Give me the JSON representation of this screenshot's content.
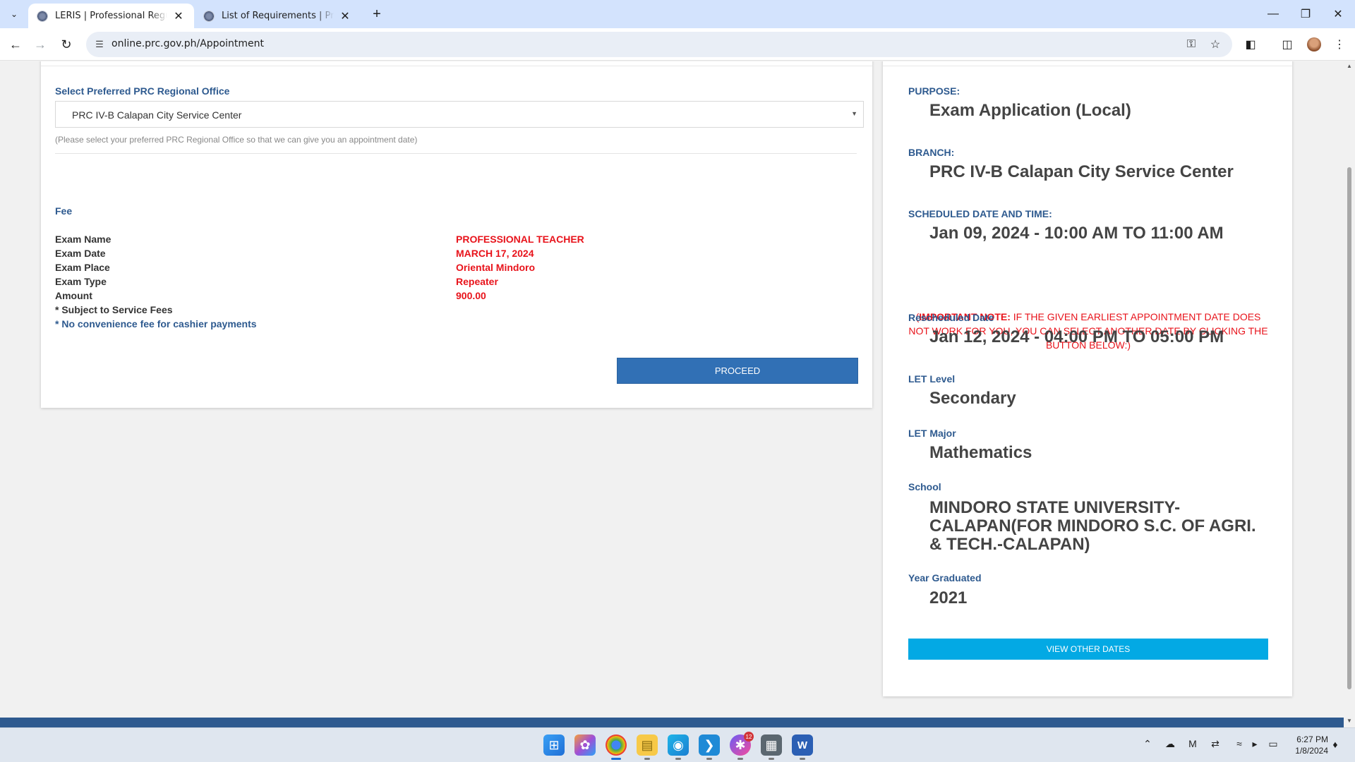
{
  "browser": {
    "tabs": [
      {
        "title": "LERIS | Professional Regulation",
        "active": true
      },
      {
        "title": "List of Requirements | Professio",
        "active": false
      }
    ],
    "url": "online.prc.gov.ph/Appointment"
  },
  "office": {
    "label": "Select Preferred PRC Regional Office",
    "selected": "PRC IV-B Calapan City Service Center",
    "hint": "(Please select your preferred PRC Regional Office so that we can give you an appointment date)"
  },
  "fee": {
    "heading": "Fee",
    "rows": [
      {
        "label": "Exam Name",
        "value": "PROFESSIONAL TEACHER"
      },
      {
        "label": "Exam Date",
        "value": "MARCH 17, 2024"
      },
      {
        "label": "Exam Place",
        "value": "Oriental Mindoro"
      },
      {
        "label": "Exam Type",
        "value": "Repeater"
      },
      {
        "label": "Amount",
        "value": "900.00"
      }
    ],
    "note1": "* Subject to Service Fees",
    "note2": "* No convenience fee for cashier payments",
    "proceed_label": "PROCEED"
  },
  "summary": {
    "purpose_label": "PURPOSE:",
    "purpose": "Exam Application (Local)",
    "branch_label": "BRANCH:",
    "branch": "PRC IV-B Calapan City Service Center",
    "schedule_label": "SCHEDULED DATE AND TIME:",
    "schedule": "Jan 09, 2024 - 10:00 AM TO 11:00 AM",
    "note_open": "(",
    "note_bold": "IMPORTANT NOTE:",
    "note_text": " IF THE GIVEN EARLIEST APPOINTMENT DATE DOES NOT WORK FOR YOU, YOU CAN SELECT ANOTHER DATE BY CLICKING THE BUTTON BELOW:)",
    "resched_label": "Rescheduled Date",
    "resched": "Jan 12, 2024 - 04:00 PM TO 05:00 PM",
    "level_label": "LET Level",
    "level": "Secondary",
    "major_label": "LET Major",
    "major": "Mathematics",
    "school_label": "School",
    "school": "MINDORO STATE UNIVERSITY-CALAPAN(FOR MINDORO S.C. OF AGRI. & TECH.-CALAPAN)",
    "year_label": "Year Graduated",
    "year": "2021",
    "view_dates_label": "VIEW OTHER DATES"
  },
  "taskbar": {
    "messenger_badge": "12",
    "time": "6:27 PM",
    "date": "1/8/2024"
  },
  "colors": {
    "label_blue": "#2e5a8f",
    "value_red": "#e8131b",
    "proceed_button": "#3170b5",
    "view_dates_button": "#03a9e4"
  }
}
